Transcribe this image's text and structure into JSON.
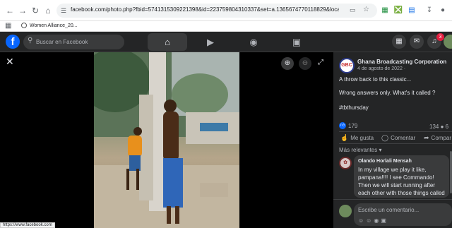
{
  "browser": {
    "url": "facebook.com/photo.php?fbid=574131530922139​8&id=223759804310337&set=a.1365674770118829&locale=km_KH",
    "bookmark": "Women Alliance_20...",
    "status_url": "https://www.facebook.com"
  },
  "header": {
    "search_placeholder": "Buscar en Facebook",
    "logo": "f",
    "notification_count": "3"
  },
  "post": {
    "page_name": "Ghana Broadcasting Corporation",
    "date": "4 de agosto de 2022 ·",
    "avatar_text": "GBC",
    "line1": "A throw back to this classic...",
    "line2": "Wrong answers only. What's it called ?",
    "hashtag": "#tbthursday",
    "reaction_count": "179",
    "comment_count": "134",
    "share_count_partial": "6",
    "actions": {
      "like": "Me gusta",
      "comment": "Comentar",
      "share": "Compar"
    },
    "sort_label": "Más relevantes"
  },
  "comment": {
    "author": "Olando Horlali Mensah",
    "text": "In my village we play it like, pampana!!!! I see Commando! Then we will start running after each other with those things called"
  },
  "compose": {
    "placeholder": "Escribe un comentario..."
  }
}
